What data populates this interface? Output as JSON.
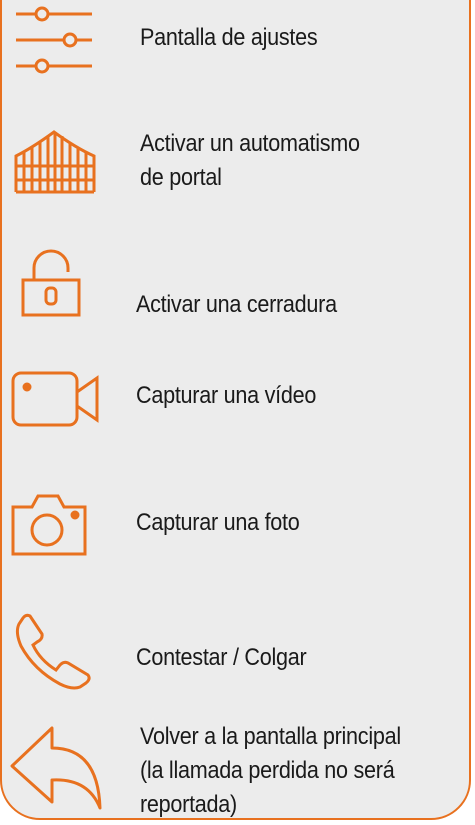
{
  "accent_color": "#e8711f",
  "items": [
    {
      "icon": "settings-sliders-icon",
      "label": "Pantalla de ajustes"
    },
    {
      "icon": "gate-icon",
      "label_line1": "Activar un automatismo",
      "label_line2": "de portal"
    },
    {
      "icon": "padlock-icon",
      "label": "Activar una cerradura"
    },
    {
      "icon": "video-camera-icon",
      "label": "Capturar una vídeo"
    },
    {
      "icon": "photo-camera-icon",
      "label": "Capturar una foto"
    },
    {
      "icon": "phone-handset-icon",
      "label": "Contestar / Colgar"
    },
    {
      "icon": "back-arrow-icon",
      "label_line1": "Volver a la pantalla principal",
      "label_line2": "(la llamada perdida no será",
      "label_line3": "reportada)"
    }
  ]
}
